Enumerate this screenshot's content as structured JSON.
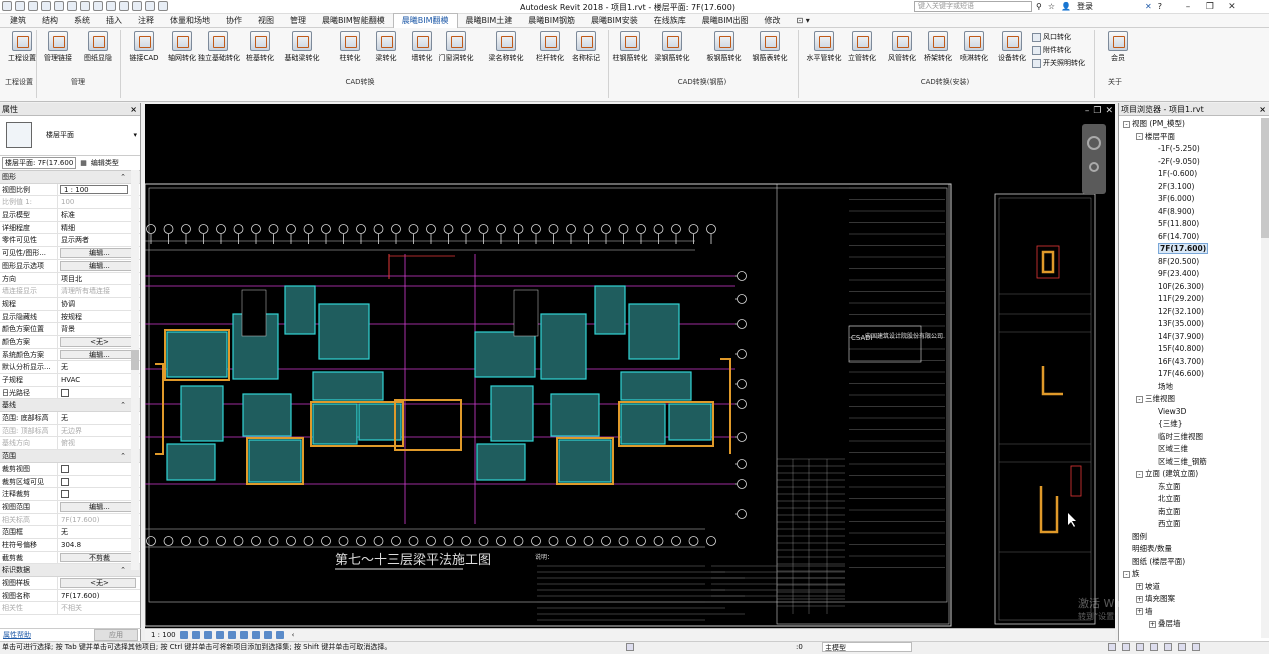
{
  "app": {
    "title": "Autodesk Revit 2018 -    项目1.rvt - 楼层平面: 7F(17.600)",
    "search_placeholder": "键入关键字或短语",
    "user": "登录"
  },
  "tabs": [
    "建筑",
    "结构",
    "系统",
    "插入",
    "注释",
    "体量和场地",
    "协作",
    "视图",
    "管理",
    "晨曦BIM智能翻模",
    "晨曦BIM翻模",
    "晨曦BIM土建",
    "晨曦BIM钢筋",
    "晨曦BIM安装",
    "在线族库",
    "晨曦BIM出图",
    "修改"
  ],
  "active_tab": "晨曦BIM翻模",
  "ribbon": {
    "buttons": [
      {
        "label": "工程设置",
        "icon": "project-settings-icon"
      },
      {
        "label": "管理链接",
        "icon": "cad-link-icon"
      },
      {
        "label": "图纸显隐",
        "icon": "cad-visibility-icon"
      },
      {
        "label": "链接CAD",
        "icon": "link-cad-icon"
      },
      {
        "label": "轴网转化",
        "icon": "grid-convert-icon"
      },
      {
        "label": "独立基础转化",
        "icon": "footing-convert-icon"
      },
      {
        "label": "桩基转化",
        "icon": "pile-convert-icon"
      },
      {
        "label": "基础梁转化",
        "icon": "foundation-beam-icon"
      },
      {
        "label": "柱转化",
        "icon": "column-convert-icon"
      },
      {
        "label": "梁转化",
        "icon": "beam-convert-icon"
      },
      {
        "label": "墙转化",
        "icon": "wall-convert-icon"
      },
      {
        "label": "门窗洞转化",
        "icon": "door-window-icon"
      },
      {
        "label": "梁名称转化",
        "icon": "beam-name-icon"
      },
      {
        "label": "栏杆转化",
        "icon": "railing-icon"
      },
      {
        "label": "名称标记",
        "icon": "tag-icon"
      },
      {
        "label": "柱钢筋转化",
        "icon": "column-rebar-icon"
      },
      {
        "label": "梁钢筋转化",
        "icon": "beam-rebar-icon"
      },
      {
        "label": "板钢筋转化",
        "icon": "slab-rebar-icon"
      },
      {
        "label": "钢筋表转化",
        "icon": "rebar-table-icon"
      },
      {
        "label": "水平管转化",
        "icon": "horizontal-pipe-icon"
      },
      {
        "label": "立管转化",
        "icon": "riser-pipe-icon"
      },
      {
        "label": "风管转化",
        "icon": "duct-icon"
      },
      {
        "label": "桥架转化",
        "icon": "cable-tray-icon"
      },
      {
        "label": "喷淋转化",
        "icon": "sprinkler-icon"
      },
      {
        "label": "设备转化",
        "icon": "equipment-icon"
      },
      {
        "label": "会员",
        "icon": "member-icon"
      }
    ],
    "small_buttons": [
      "风口转化",
      "附件转化",
      "开关照明转化"
    ],
    "groups": [
      "工程设置",
      "管理",
      "CAD转换",
      "CAD转换(钢筋)",
      "CAD转换(安装)",
      "关于"
    ]
  },
  "properties": {
    "title": "属性",
    "type_name": "楼层平面",
    "filter_value": "楼层平面: 7F(17.600",
    "edit_type": "编辑类型",
    "rows": [
      {
        "cat": "图形"
      },
      {
        "k": "视图比例",
        "v": "1 : 100",
        "style": "box"
      },
      {
        "k": "比例值 1:",
        "v": "100",
        "dis": true
      },
      {
        "k": "显示模型",
        "v": "标准"
      },
      {
        "k": "详细程度",
        "v": "精细"
      },
      {
        "k": "零件可见性",
        "v": "显示两者"
      },
      {
        "k": "可见性/图形...",
        "v": "编辑...",
        "style": "btn"
      },
      {
        "k": "图形显示选项",
        "v": "编辑...",
        "style": "btn"
      },
      {
        "k": "方向",
        "v": "项目北"
      },
      {
        "k": "墙连接显示",
        "v": "清理所有墙连接",
        "dis": true
      },
      {
        "k": "规程",
        "v": "协调"
      },
      {
        "k": "显示隐藏线",
        "v": "按规程"
      },
      {
        "k": "颜色方案位置",
        "v": "背景"
      },
      {
        "k": "颜色方案",
        "v": "<无>",
        "style": "btn"
      },
      {
        "k": "系统颜色方案",
        "v": "编辑...",
        "style": "btn"
      },
      {
        "k": "默认分析显示...",
        "v": "无"
      },
      {
        "k": "子规程",
        "v": "HVAC"
      },
      {
        "k": "日光路径",
        "v": "",
        "style": "cb"
      },
      {
        "cat": "基线"
      },
      {
        "k": "范围: 底部标高",
        "v": "无"
      },
      {
        "k": "范围: 顶部标高",
        "v": "无边界",
        "dis": true
      },
      {
        "k": "基线方向",
        "v": "俯视",
        "dis": true
      },
      {
        "cat": "范围"
      },
      {
        "k": "裁剪视图",
        "v": "",
        "style": "cb"
      },
      {
        "k": "裁剪区域可见",
        "v": "",
        "style": "cb"
      },
      {
        "k": "注释裁剪",
        "v": "",
        "style": "cb"
      },
      {
        "k": "视图范围",
        "v": "编辑...",
        "style": "btn"
      },
      {
        "k": "相关标高",
        "v": "7F(17.600)",
        "dis": true
      },
      {
        "k": "范围框",
        "v": "无"
      },
      {
        "k": "柱符号偏移",
        "v": "304.8"
      },
      {
        "k": "截剪裁",
        "v": "不剪裁",
        "style": "btn"
      },
      {
        "cat": "标识数据"
      },
      {
        "k": "视图样板",
        "v": "<无>",
        "style": "btn"
      },
      {
        "k": "视图名称",
        "v": "7F(17.600)"
      },
      {
        "k": "相关性",
        "v": "不相关",
        "dis": true
      }
    ],
    "help_link": "属性帮助",
    "apply": "应用"
  },
  "drawing": {
    "plan_title": "第七～十三层梁平法施工图",
    "company": "中国建筑设计院股份有限公司",
    "company_abbr": "CSADI",
    "note_heading": "说明："
  },
  "view_bar": {
    "scale": "1 : 100"
  },
  "browser": {
    "title": "项目浏览器 - 项目1.rvt",
    "nodes": [
      {
        "t": "视图 (PM_模型)",
        "lvl": 0,
        "tg": "-"
      },
      {
        "t": "楼层平面",
        "lvl": 1,
        "tg": "-"
      },
      {
        "t": "-1F(-5.250)",
        "lvl": 2
      },
      {
        "t": "-2F(-9.050)",
        "lvl": 2
      },
      {
        "t": "1F(-0.600)",
        "lvl": 2
      },
      {
        "t": "2F(3.100)",
        "lvl": 2
      },
      {
        "t": "3F(6.000)",
        "lvl": 2
      },
      {
        "t": "4F(8.900)",
        "lvl": 2
      },
      {
        "t": "5F(11.800)",
        "lvl": 2
      },
      {
        "t": "6F(14.700)",
        "lvl": 2
      },
      {
        "t": "7F(17.600)",
        "lvl": 2,
        "sel": true
      },
      {
        "t": "8F(20.500)",
        "lvl": 2
      },
      {
        "t": "9F(23.400)",
        "lvl": 2
      },
      {
        "t": "10F(26.300)",
        "lvl": 2
      },
      {
        "t": "11F(29.200)",
        "lvl": 2
      },
      {
        "t": "12F(32.100)",
        "lvl": 2
      },
      {
        "t": "13F(35.000)",
        "lvl": 2
      },
      {
        "t": "14F(37.900)",
        "lvl": 2
      },
      {
        "t": "15F(40.800)",
        "lvl": 2
      },
      {
        "t": "16F(43.700)",
        "lvl": 2
      },
      {
        "t": "17F(46.600)",
        "lvl": 2
      },
      {
        "t": "场地",
        "lvl": 2
      },
      {
        "t": "三维视图",
        "lvl": 1,
        "tg": "-"
      },
      {
        "t": "View3D",
        "lvl": 2
      },
      {
        "t": "{三维}",
        "lvl": 2
      },
      {
        "t": "临时三维视图",
        "lvl": 2
      },
      {
        "t": "区域三维",
        "lvl": 2
      },
      {
        "t": "区域三维_钢筋",
        "lvl": 2
      },
      {
        "t": "立面 (建筑立面)",
        "lvl": 1,
        "tg": "-"
      },
      {
        "t": "东立面",
        "lvl": 2
      },
      {
        "t": "北立面",
        "lvl": 2
      },
      {
        "t": "南立面",
        "lvl": 2
      },
      {
        "t": "西立面",
        "lvl": 2
      },
      {
        "t": "图例",
        "lvl": 0
      },
      {
        "t": "明细表/数量",
        "lvl": 0
      },
      {
        "t": "图纸 (楼层平面)",
        "lvl": 0
      },
      {
        "t": "族",
        "lvl": 0,
        "tg": "-"
      },
      {
        "t": "坡道",
        "lvl": 1,
        "tg": "+"
      },
      {
        "t": "填充图案",
        "lvl": 1,
        "tg": "+"
      },
      {
        "t": "墙",
        "lvl": 1,
        "tg": "+"
      },
      {
        "t": "叠层墙",
        "lvl": 2,
        "tg": "+"
      }
    ]
  },
  "watermark": {
    "line1": "激活 Windows",
    "line2": "转到“设置”以激活 Windows。"
  },
  "status": {
    "message": "单击可进行选择; 按 Tab 键并单击可选择其他项目; 按 Ctrl 键并单击可将新项目添加到选择集; 按 Shift 键并单击可取消选择。",
    "workset": "主模型",
    "zero": ":0"
  }
}
